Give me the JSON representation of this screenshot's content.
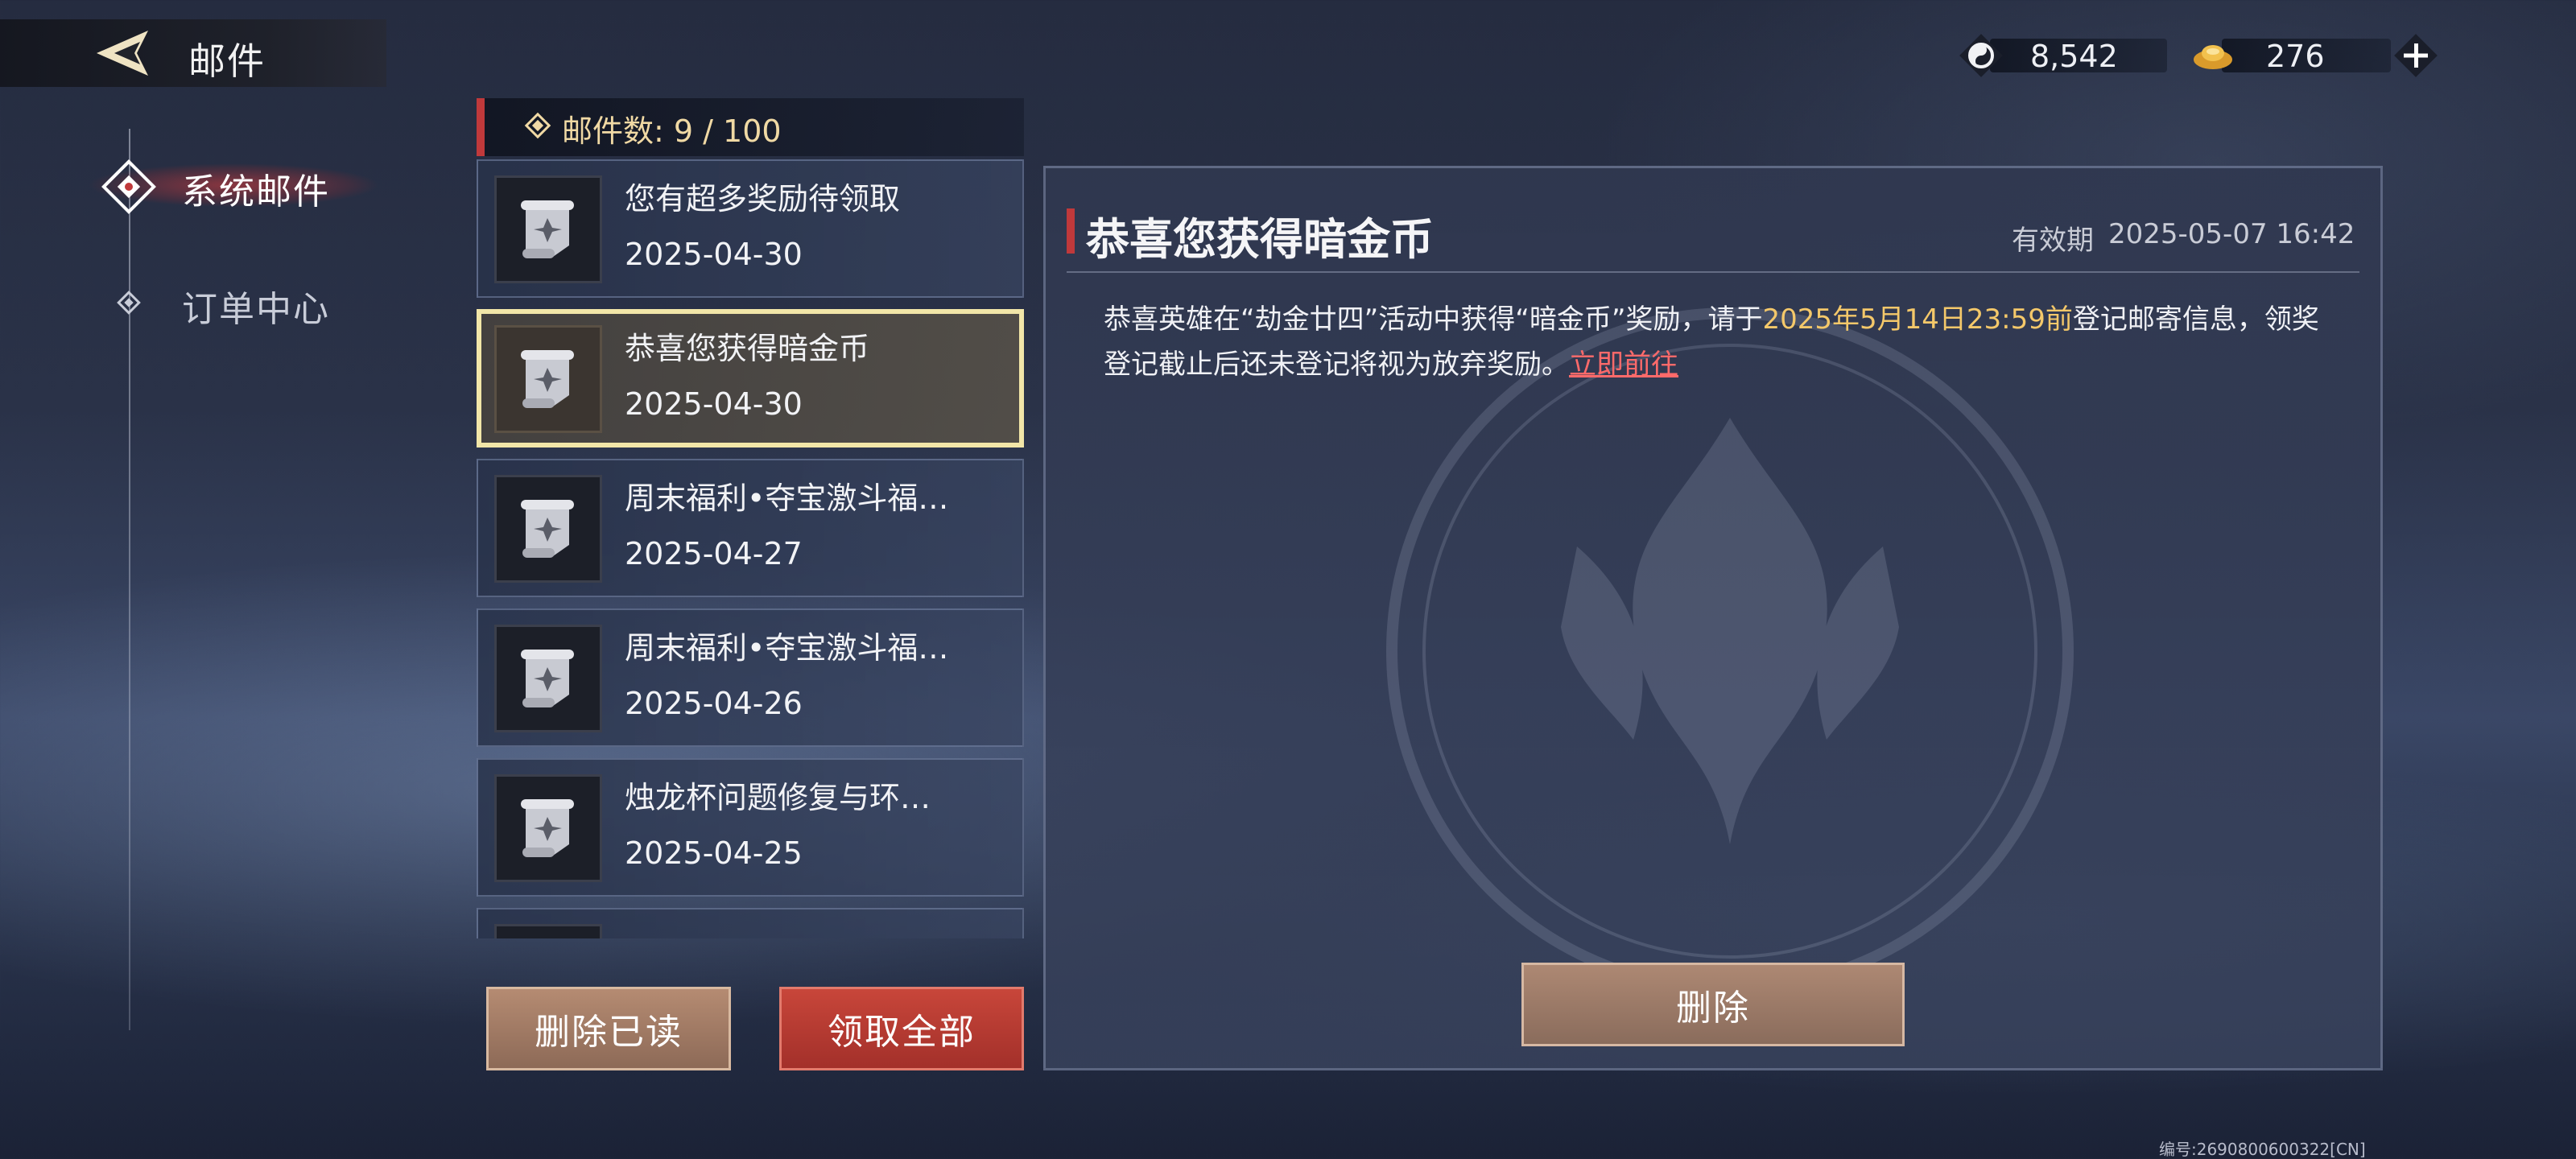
{
  "header": {
    "title": "邮件"
  },
  "currencies": [
    {
      "icon": "spirit-coin-icon",
      "value": "8,542"
    },
    {
      "icon": "gold-ingot-icon",
      "value": "276"
    }
  ],
  "nav": {
    "items": [
      {
        "label": "系统邮件",
        "active": true
      },
      {
        "label": "订单中心",
        "active": false
      }
    ]
  },
  "mail_count": {
    "label": "邮件数: 9 / 100"
  },
  "mails": [
    {
      "title": "您有超多奖励待领取",
      "date": "2025-04-30",
      "selected": false
    },
    {
      "title": "恭喜您获得暗金币",
      "date": "2025-04-30",
      "selected": true
    },
    {
      "title": "周末福利•夺宝激斗福…",
      "date": "2025-04-27",
      "selected": false
    },
    {
      "title": "周末福利•夺宝激斗福…",
      "date": "2025-04-26",
      "selected": false
    },
    {
      "title": "烛龙杯问题修复与环…",
      "date": "2025-04-25",
      "selected": false
    }
  ],
  "buttons": {
    "delete_read": "删除已读",
    "claim_all": "领取全部",
    "delete": "删除"
  },
  "detail": {
    "title": "恭喜您获得暗金币",
    "expiry_label": "有效期",
    "expiry_value": "2025-05-07 16:42",
    "body_part1": "恭喜英雄在“劫金廿四”活动中获得“暗金币”奖励，请于",
    "body_highlight": "2025年5月14日23:59前",
    "body_part2": "登记邮寄信息，领奖登记截止后还未登记将视为放弃奖励。",
    "body_link": "立即前往"
  },
  "footer_id": "编号:2690800600322[CN]",
  "colors": {
    "accent_red": "#c0393b",
    "highlight_gold": "#f4c86a",
    "link_red": "#ff6a6a",
    "selected_border": "#f2e6a8"
  }
}
